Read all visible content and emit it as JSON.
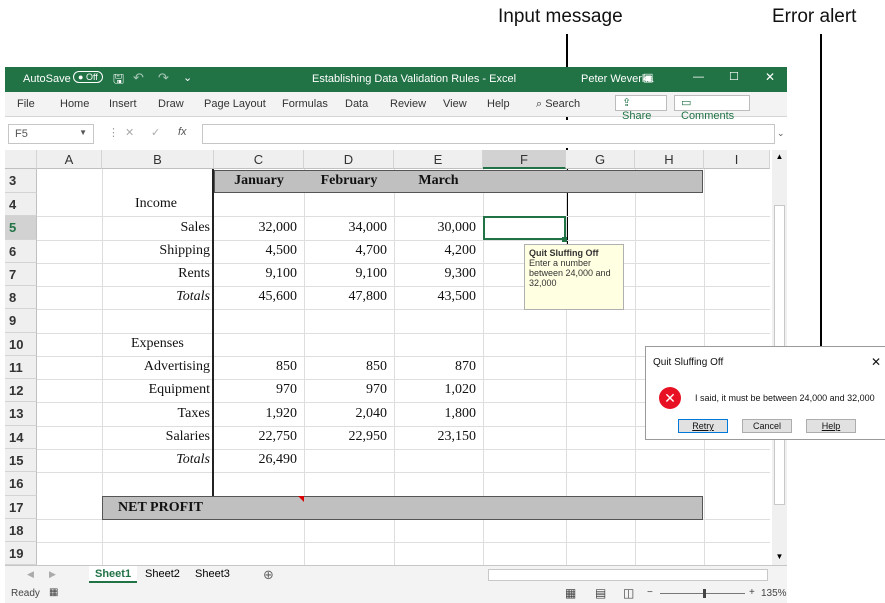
{
  "callouts": {
    "input_message": "Input message",
    "error_alert": "Error alert"
  },
  "titlebar": {
    "autosave": "AutoSave",
    "autosave_state": "Off",
    "title": "Establishing Data Validation Rules - Excel",
    "user": "Peter Weverka"
  },
  "menu": [
    "File",
    "Home",
    "Insert",
    "Draw",
    "Page Layout",
    "Formulas",
    "Data",
    "Review",
    "View",
    "Help"
  ],
  "search_label": "Search",
  "share_label": "Share",
  "comments_label": "Comments",
  "namebox": "F5",
  "fx": "fx",
  "columns": [
    "A",
    "B",
    "C",
    "D",
    "E",
    "F",
    "G",
    "H",
    "I"
  ],
  "rows": [
    "3",
    "4",
    "5",
    "6",
    "7",
    "8",
    "9",
    "10",
    "11",
    "12",
    "13",
    "14",
    "15",
    "16",
    "17",
    "18",
    "19"
  ],
  "sheet": {
    "months": [
      "January",
      "February",
      "March"
    ],
    "income_label": "Income",
    "income": [
      {
        "label": "Sales",
        "vals": [
          "32,000",
          "34,000",
          "30,000"
        ]
      },
      {
        "label": "Shipping",
        "vals": [
          "4,500",
          "4,700",
          "4,200"
        ]
      },
      {
        "label": "Rents",
        "vals": [
          "9,100",
          "9,100",
          "9,300"
        ]
      },
      {
        "label": "Totals",
        "vals": [
          "45,600",
          "47,800",
          "43,500"
        ]
      }
    ],
    "expenses_label": "Expenses",
    "expenses": [
      {
        "label": "Advertising",
        "vals": [
          "850",
          "850",
          "870"
        ]
      },
      {
        "label": "Equipment",
        "vals": [
          "970",
          "970",
          "1,020"
        ]
      },
      {
        "label": "Taxes",
        "vals": [
          "1,920",
          "2,040",
          "1,800"
        ]
      },
      {
        "label": "Salaries",
        "vals": [
          "22,750",
          "22,950",
          "23,150"
        ]
      },
      {
        "label": "Totals",
        "vals": [
          "26,490",
          "",
          ""
        ]
      }
    ],
    "net_profit": "NET PROFIT"
  },
  "input_message": {
    "title": "Quit Sluffing Off",
    "body": "Enter a number between 24,000 and 32,000"
  },
  "error_dialog": {
    "title": "Quit Sluffing Off",
    "message": "I said, it must be between 24,000 and 32,000",
    "retry": "Retry",
    "cancel": "Cancel",
    "help": "Help"
  },
  "tabs": [
    "Sheet1",
    "Sheet2",
    "Sheet3"
  ],
  "status": {
    "ready": "Ready",
    "zoom": "135%"
  },
  "colors": {
    "excel_green": "#217346",
    "header_band": "#c0c0c0",
    "input_msg_bg": "#ffffe1",
    "error_red": "#e81123"
  }
}
